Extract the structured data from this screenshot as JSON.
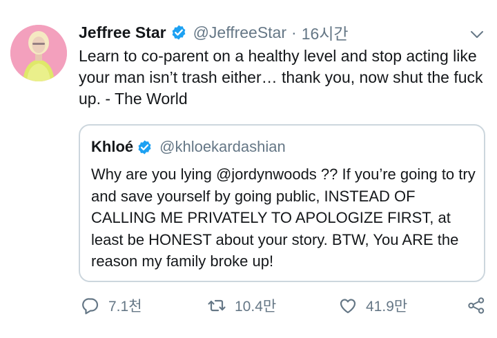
{
  "tweet": {
    "display_name": "Jeffree Star",
    "handle": "@JeffreeStar",
    "separator": "·",
    "timestamp": "16시간",
    "text": "Learn to co-parent on a healthy level and stop acting like your man isn’t trash either… thank you, now shut the fuck up. - The World",
    "avatar_icon": "profile-photo",
    "verified_color": "#1da1f2"
  },
  "quote": {
    "display_name": "Khloé",
    "handle": "@khloekardashian",
    "text": "Why are you lying @jordynwoods ?? If you’re going to try and save yourself by going public, INSTEAD OF CALLING ME PRIVATELY TO APOLOGIZE FIRST, at least be HONEST about your story. BTW, You ARE the reason my family broke up!"
  },
  "actions": {
    "reply_count": "7.1천",
    "retweet_count": "10.4만",
    "like_count": "41.9만"
  },
  "colors": {
    "text": "#14171a",
    "secondary": "#657786",
    "border": "#ccd6dd",
    "accent": "#1da1f2"
  }
}
